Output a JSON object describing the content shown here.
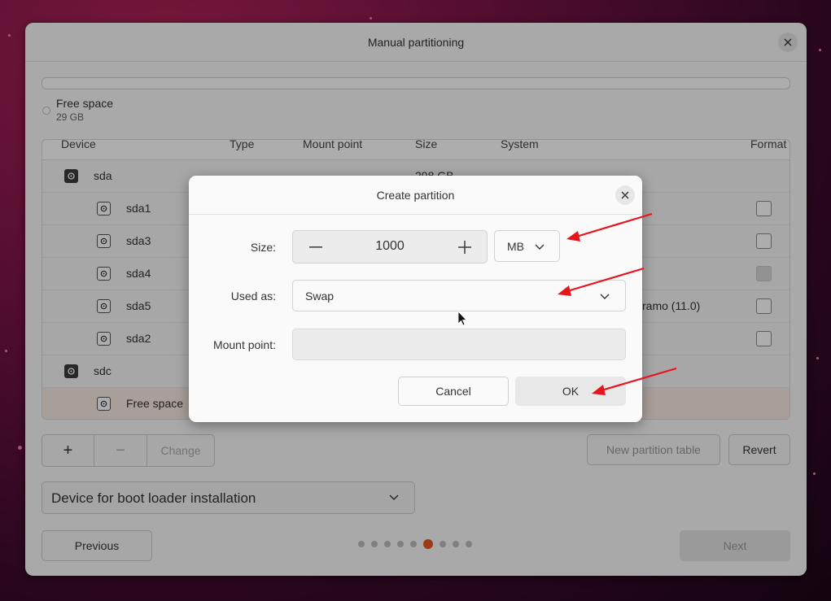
{
  "window": {
    "title": "Manual partitioning"
  },
  "legend": {
    "label": "Free space",
    "size": "29 GB"
  },
  "table": {
    "headers": [
      "Device",
      "Type",
      "Mount point",
      "Size",
      "System",
      "Format"
    ],
    "rows": [
      {
        "name": "sda",
        "kind": "disk",
        "size": "298 GB"
      },
      {
        "name": "sda1",
        "kind": "partition"
      },
      {
        "name": "sda3",
        "kind": "partition"
      },
      {
        "name": "sda4",
        "kind": "partition"
      },
      {
        "name": "sda5",
        "kind": "partition",
        "system": "ramo (11.0)"
      },
      {
        "name": "sda2",
        "kind": "partition"
      },
      {
        "name": "sdc",
        "kind": "disk"
      },
      {
        "name": "Free space",
        "kind": "partition"
      }
    ]
  },
  "toolbar": {
    "add_label": "+",
    "remove_label": "−",
    "change_label": "Change",
    "new_table_label": "New partition table",
    "revert_label": "Revert"
  },
  "bootloader": {
    "label": "Device for boot loader installation"
  },
  "nav": {
    "previous_label": "Previous",
    "next_label": "Next"
  },
  "dialog": {
    "title": "Create partition",
    "size_label": "Size:",
    "size_value": "1000",
    "unit": "MB",
    "used_as_label": "Used as:",
    "used_as_value": "Swap",
    "mount_label": "Mount point:",
    "mount_value": "",
    "cancel_label": "Cancel",
    "ok_label": "OK"
  },
  "colors": {
    "accent": "#e95420",
    "annotation": "#e8141c"
  }
}
